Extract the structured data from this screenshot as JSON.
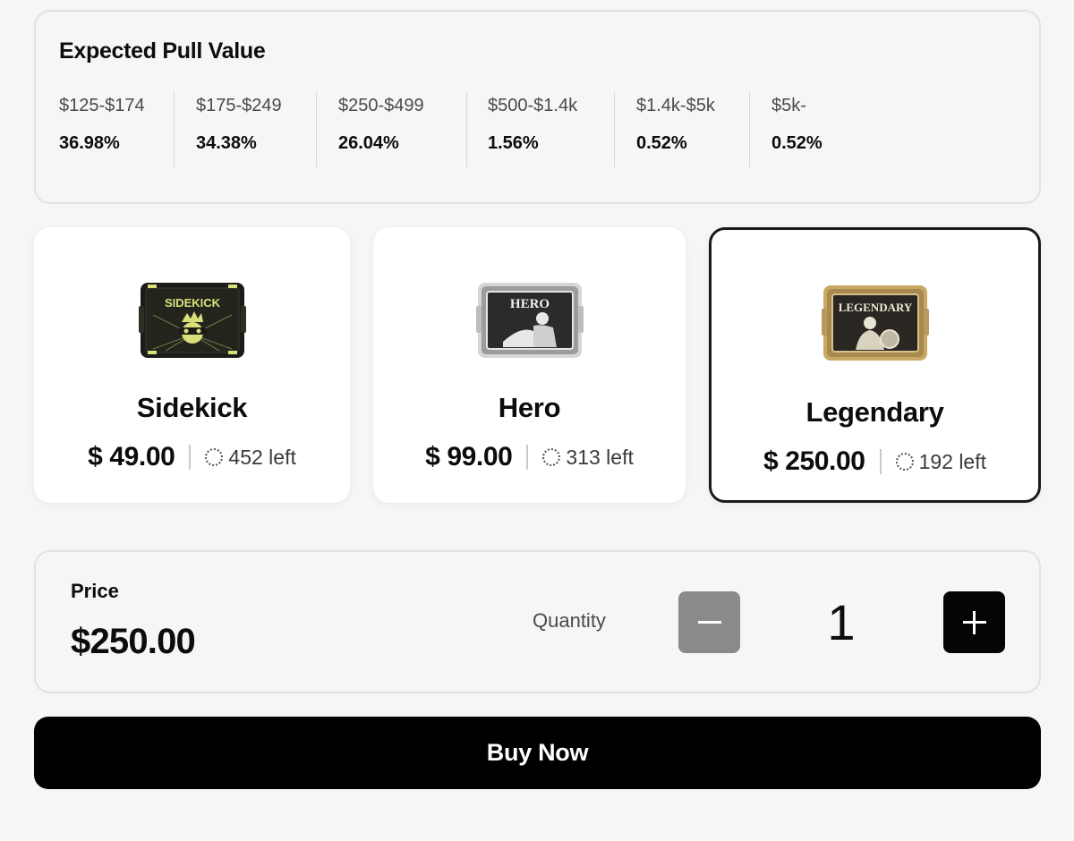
{
  "pull_value": {
    "title": "Expected Pull Value",
    "columns": [
      {
        "range": "$125-$174",
        "percent": "36.98%"
      },
      {
        "range": "$175-$249",
        "percent": "34.38%"
      },
      {
        "range": "$250-$499",
        "percent": "26.04%"
      },
      {
        "range": "$500-$1.4k",
        "percent": "1.56%"
      },
      {
        "range": "$1.4k-$5k",
        "percent": "0.52%"
      },
      {
        "range": "$5k-",
        "percent": "0.52%"
      }
    ]
  },
  "tiers": [
    {
      "name": "Sidekick",
      "case_label": "SIDEKICK",
      "price": "$ 49.00",
      "left": "452 left",
      "selected": false,
      "accent": "#d9e07a"
    },
    {
      "name": "Hero",
      "case_label": "HERO",
      "price": "$ 99.00",
      "left": "313 left",
      "selected": false,
      "accent": "#c9c9c9"
    },
    {
      "name": "Legendary",
      "case_label": "LEGENDARY",
      "price": "$ 250.00",
      "left": "192 left",
      "selected": true,
      "accent": "#c9a866"
    }
  ],
  "order": {
    "price_label": "Price",
    "price_value": "$250.00",
    "quantity_label": "Quantity",
    "quantity_value": "1"
  },
  "buy_button": {
    "label": "Buy Now"
  },
  "colors": {
    "background": "#f6f6f6",
    "card": "#ffffff",
    "primary": "#000000",
    "disabled_button": "#8a8a8a"
  }
}
